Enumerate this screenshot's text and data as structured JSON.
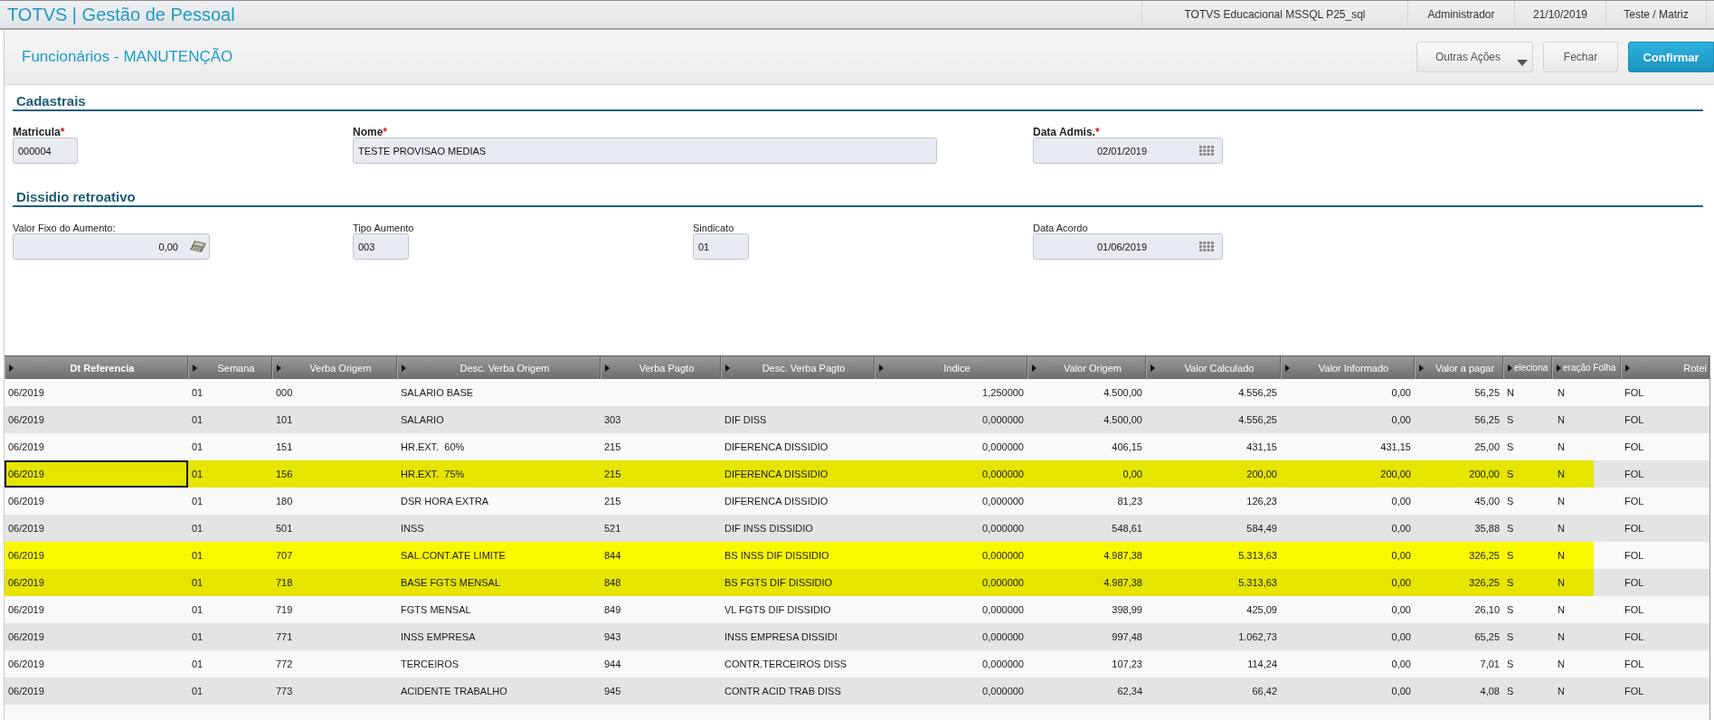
{
  "app_bar": {
    "title": "TOTVS | Gestão de Pessoal",
    "info": [
      "TOTVS Educacional MSSQL P25_sql",
      "Administrador",
      "21/10/2019",
      "Teste / Matriz"
    ]
  },
  "page_header": {
    "title": "Funcionários - MANUTENÇÃO",
    "buttons": [
      {
        "label": "Outras Ações",
        "kind": "dropdown"
      },
      {
        "label": "Fechar",
        "kind": "default"
      },
      {
        "label": "Confirmar",
        "kind": "primary"
      }
    ]
  },
  "sections": [
    {
      "title": "Cadastrais",
      "fields": [
        {
          "label": "Matricula",
          "required_mark": "*",
          "kind": "text",
          "value": "000004"
        },
        {
          "label": "Nome",
          "required_mark": "*",
          "kind": "text",
          "value": "TESTE PROVISAO MEDIAS"
        },
        {
          "label": "Data Admis.",
          "required_mark": "*",
          "kind": "date",
          "value": "02/01/2019"
        }
      ]
    },
    {
      "title": "Dissidio retroativo",
      "fields": [
        {
          "label": "Valor Fixo do Aumento:",
          "kind": "number",
          "value": "0,00"
        },
        {
          "label": "Tipo Aumento",
          "kind": "text",
          "value": "003"
        },
        {
          "label": "Sindicato",
          "kind": "text",
          "value": "01"
        },
        {
          "label": "Data Acordo",
          "kind": "date",
          "value": "01/06/2019"
        }
      ]
    }
  ],
  "table": {
    "columns": [
      {
        "label": "Dt Referencia",
        "sorted": true
      },
      {
        "label": "Semana",
        "sorted": false
      },
      {
        "label": "Verba Origem",
        "sorted": false
      },
      {
        "label": "Desc. Verba Origem",
        "sorted": false
      },
      {
        "label": "Verba Pagto",
        "sorted": false
      },
      {
        "label": "Desc. Verba Pagto",
        "sorted": false
      },
      {
        "label": "Indice",
        "sorted": false
      },
      {
        "label": "Valor Origem",
        "sorted": false
      },
      {
        "label": "Valor Calculado",
        "sorted": false
      },
      {
        "label": "Valor Informado",
        "sorted": false
      },
      {
        "label": "Valor a pagar",
        "sorted": false
      },
      {
        "label": "eleciona",
        "sorted": false
      },
      {
        "label": "eração Folha",
        "sorted": false
      },
      {
        "label": "Rotei",
        "sorted": false
      }
    ],
    "rows": [
      {
        "highlighted": false,
        "focused": false,
        "dt_referencia": "06/2019",
        "semana": "01",
        "verba_origem": "000",
        "desc_verba_origem": "SALARIO BASE",
        "indice": "1,250000",
        "valor_origem": "4.500,00",
        "valor_calculado": "4.556,25",
        "valor_informado": "0,00",
        "valor_a_pagar": "56,25",
        "column_12": "N",
        "column_13": "N",
        "column_14": "FOL"
      },
      {
        "highlighted": false,
        "focused": false,
        "dt_referencia": "06/2019",
        "semana": "01",
        "verba_origem": "101",
        "desc_verba_origem": "SALARIO",
        "verba_pagto": "303",
        "desc_verba_pagto": "DIF DISS",
        "indice": "0,000000",
        "valor_origem": "4.500,00",
        "valor_calculado": "4.556,25",
        "valor_informado": "0,00",
        "valor_a_pagar": "56,25",
        "column_12": "S",
        "column_13": "N",
        "column_14": "FOL"
      },
      {
        "highlighted": false,
        "focused": false,
        "dt_referencia": "06/2019",
        "semana": "01",
        "verba_origem": "151",
        "desc_verba_origem": "HR.EXT.  60%",
        "verba_pagto": "215",
        "desc_verba_pagto": "DIFERENCA DISSIDIO",
        "indice": "0,000000",
        "valor_origem": "406,15",
        "valor_calculado": "431,15",
        "valor_informado": "431,15",
        "valor_a_pagar": "25,00",
        "column_12": "S",
        "column_13": "N",
        "column_14": "FOL"
      },
      {
        "highlighted": true,
        "focused": true,
        "dt_referencia": "06/2019",
        "semana": "01",
        "verba_origem": "156",
        "desc_verba_origem": "HR.EXT.  75%",
        "verba_pagto": "215",
        "desc_verba_pagto": "DIFERENCA DISSIDIO",
        "indice": "0,000000",
        "valor_origem": "0,00",
        "valor_calculado": "200,00",
        "valor_informado": "200,00",
        "valor_a_pagar": "200,00",
        "column_12": "S",
        "column_13": "N",
        "column_14": "FOL"
      },
      {
        "highlighted": false,
        "focused": false,
        "dt_referencia": "06/2019",
        "semana": "01",
        "verba_origem": "180",
        "desc_verba_origem": "DSR HORA EXTRA",
        "verba_pagto": "215",
        "desc_verba_pagto": "DIFERENCA DISSIDIO",
        "indice": "0,000000",
        "valor_origem": "81,23",
        "valor_calculado": "126,23",
        "valor_informado": "0,00",
        "valor_a_pagar": "45,00",
        "column_12": "S",
        "column_13": "N",
        "column_14": "FOL"
      },
      {
        "highlighted": false,
        "focused": false,
        "dt_referencia": "06/2019",
        "semana": "01",
        "verba_origem": "501",
        "desc_verba_origem": "INSS",
        "verba_pagto": "521",
        "desc_verba_pagto": "DIF INSS DISSIDIO",
        "indice": "0,000000",
        "valor_origem": "548,61",
        "valor_calculado": "584,49",
        "valor_informado": "0,00",
        "valor_a_pagar": "35,88",
        "column_12": "S",
        "column_13": "N",
        "column_14": "FOL"
      },
      {
        "highlighted": true,
        "focused": false,
        "dt_referencia": "06/2019",
        "semana": "01",
        "verba_origem": "707",
        "desc_verba_origem": "SAL.CONT.ATE LIMITE",
        "verba_pagto": "844",
        "desc_verba_pagto": "BS INSS DIF DISSIDIO",
        "indice": "0,000000",
        "valor_origem": "4.987,38",
        "valor_calculado": "5.313,63",
        "valor_informado": "0,00",
        "valor_a_pagar": "326,25",
        "column_12": "S",
        "column_13": "N",
        "column_14": "FOL"
      },
      {
        "highlighted": true,
        "focused": false,
        "dt_referencia": "06/2019",
        "semana": "01",
        "verba_origem": "718",
        "desc_verba_origem": "BASE FGTS MENSAL",
        "verba_pagto": "848",
        "desc_verba_pagto": "BS FGTS DIF DISSIDIO",
        "indice": "0,000000",
        "valor_origem": "4.987,38",
        "valor_calculado": "5.313,63",
        "valor_informado": "0,00",
        "valor_a_pagar": "326,25",
        "column_12": "S",
        "column_13": "N",
        "column_14": "FOL"
      },
      {
        "highlighted": false,
        "focused": false,
        "dt_referencia": "06/2019",
        "semana": "01",
        "verba_origem": "719",
        "desc_verba_origem": "FGTS MENSAL",
        "verba_pagto": "849",
        "desc_verba_pagto": "VL FGTS DIF DISSIDIO",
        "indice": "0,000000",
        "valor_origem": "398,99",
        "valor_calculado": "425,09",
        "valor_informado": "0,00",
        "valor_a_pagar": "26,10",
        "column_12": "S",
        "column_13": "N",
        "column_14": "FOL"
      },
      {
        "highlighted": false,
        "focused": false,
        "dt_referencia": "06/2019",
        "semana": "01",
        "verba_origem": "771",
        "desc_verba_origem": "INSS EMPRESA",
        "verba_pagto": "943",
        "desc_verba_pagto": "INSS EMPRESA DISSIDI",
        "indice": "0,000000",
        "valor_origem": "997,48",
        "valor_calculado": "1.062,73",
        "valor_informado": "0,00",
        "valor_a_pagar": "65,25",
        "column_12": "S",
        "column_13": "N",
        "column_14": "FOL"
      },
      {
        "highlighted": false,
        "focused": false,
        "dt_referencia": "06/2019",
        "semana": "01",
        "verba_origem": "772",
        "desc_verba_origem": "TERCEIROS",
        "verba_pagto": "944",
        "desc_verba_pagto": "CONTR.TERCEIROS DISS",
        "indice": "0,000000",
        "valor_origem": "107,23",
        "valor_calculado": "114,24",
        "valor_informado": "0,00",
        "valor_a_pagar": "7,01",
        "column_12": "S",
        "column_13": "N",
        "column_14": "FOL"
      },
      {
        "highlighted": false,
        "focused": false,
        "dt_referencia": "06/2019",
        "semana": "01",
        "verba_origem": "773",
        "desc_verba_origem": "ACIDENTE TRABALHO",
        "verba_pagto": "945",
        "desc_verba_pagto": "CONTR ACID TRAB DISS",
        "indice": "0,000000",
        "valor_origem": "62,34",
        "valor_calculado": "66,42",
        "valor_informado": "0,00",
        "valor_a_pagar": "4,08",
        "column_12": "S",
        "column_13": "N",
        "column_14": "FOL"
      }
    ]
  }
}
